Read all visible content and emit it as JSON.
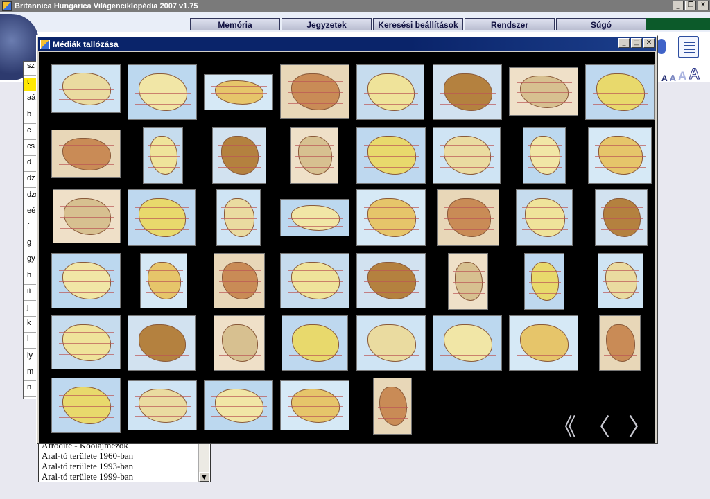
{
  "app": {
    "title": "Britannica Hungarica Világenciklopédia 2007 v1.75",
    "window_controls": [
      "_",
      "❐",
      "✕"
    ]
  },
  "menu": [
    {
      "label": "Memória"
    },
    {
      "label": "Jegyzetek"
    },
    {
      "label": "Keresési beállítások"
    },
    {
      "label": "Rendszer"
    },
    {
      "label": "Súgó"
    }
  ],
  "font_size_buttons": [
    "A",
    "A",
    "A",
    "A"
  ],
  "index_letters": [
    "sz",
    "t",
    "aá",
    "b",
    "c",
    "cs",
    "d",
    "dz",
    "dzs",
    "eé",
    "f",
    "g",
    "gy",
    "h",
    "ií",
    "j",
    "k",
    "l",
    "ly",
    "m",
    "n"
  ],
  "index_selected": 1,
  "result_list": [
    "Afrodité - Kőolajmezők",
    "Aral-tó területe 1960-ban",
    "Aral-tó területe 1993-ban",
    "Aral-tó területe 1999-ban"
  ],
  "dialog": {
    "title": "Médiák tallózása",
    "controls": [
      "_",
      "□",
      "✕"
    ],
    "nav": {
      "first": "《",
      "prev": "〈",
      "next": "〉"
    }
  },
  "colors": {
    "titlebar_active": "#0a246a",
    "titlebar_inactive": "#7a7a7a",
    "index_highlight": "#ffe800",
    "thumb_bg": "#000000"
  }
}
